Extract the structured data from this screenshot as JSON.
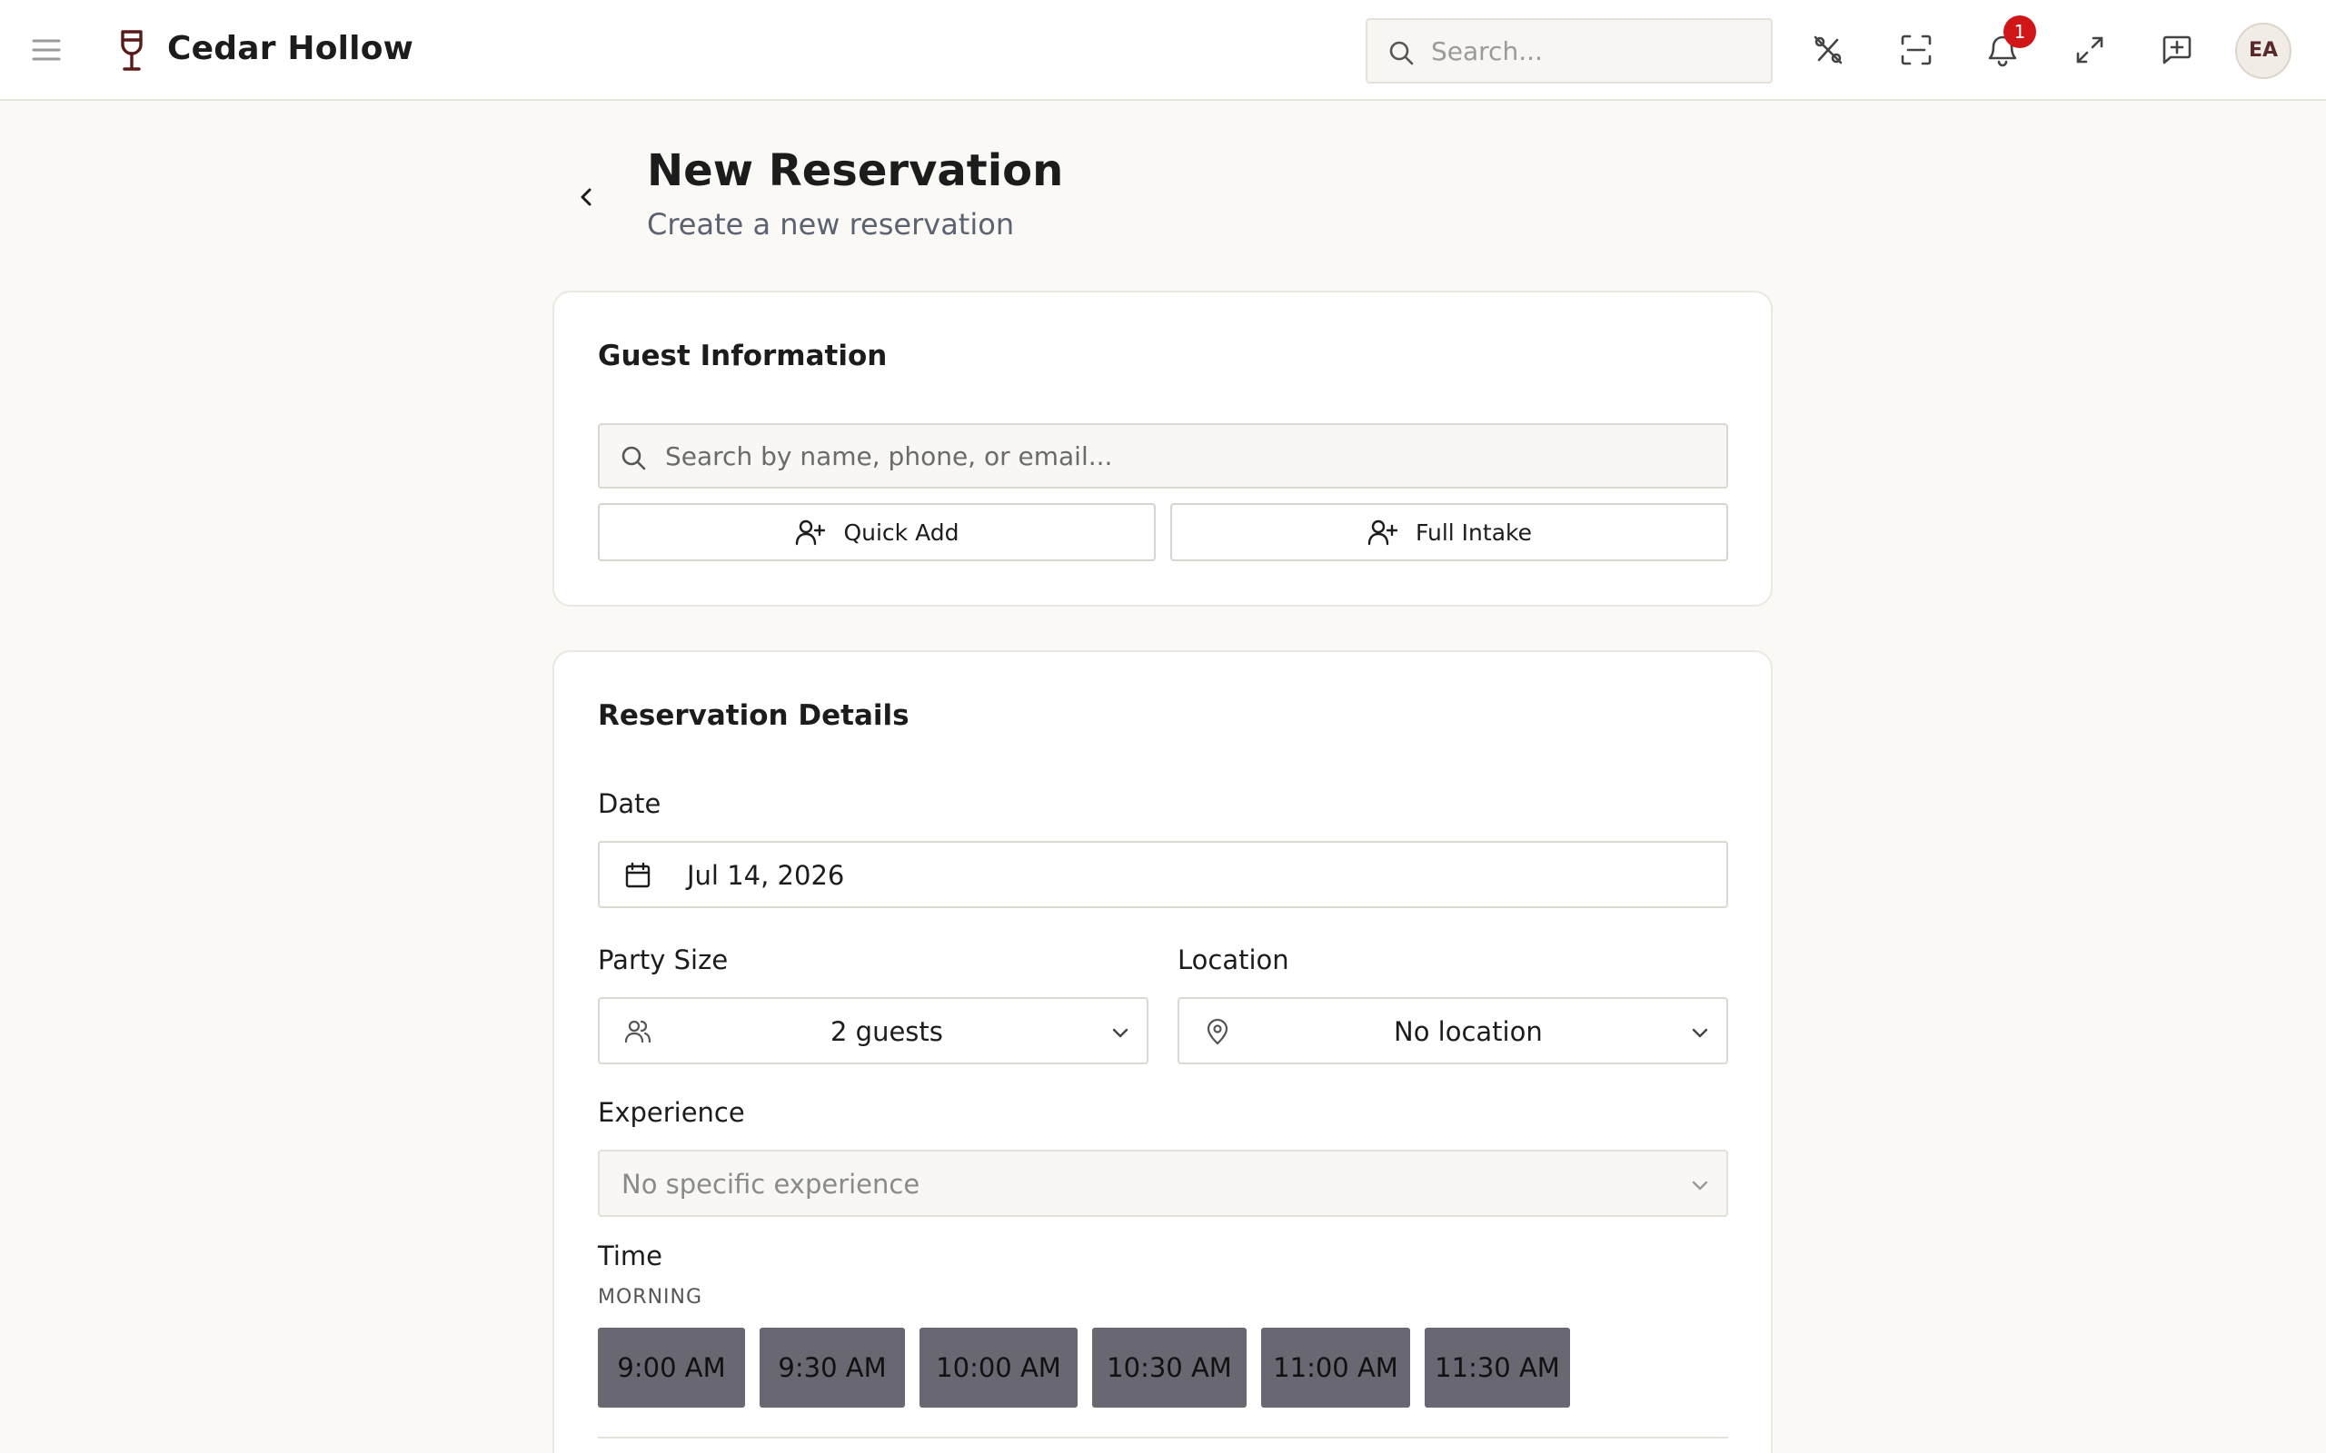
{
  "app": {
    "name": "Cedar Hollow"
  },
  "topbar": {
    "search_placeholder": "Search...",
    "notification_count": "1",
    "user_initials": "EA",
    "icons": [
      "menu-icon",
      "wine-glass-icon",
      "search-icon",
      "percent-slash-icon",
      "scan-icon",
      "bell-icon",
      "expand-icon",
      "message-plus-icon"
    ]
  },
  "header": {
    "title": "New Reservation",
    "subtitle": "Create a new reservation"
  },
  "guest": {
    "title": "Guest Information",
    "search_placeholder": "Search by name, phone, or email...",
    "quick_add_label": "Quick Add",
    "full_intake_label": "Full Intake"
  },
  "reservation": {
    "title": "Reservation Details",
    "date_label": "Date",
    "date_value": "Jul 14, 2026",
    "party_size_label": "Party Size",
    "party_size_value": "2 guests",
    "location_label": "Location",
    "location_value": "No location",
    "experience_label": "Experience",
    "experience_value": "No specific experience",
    "time_label": "Time",
    "morning_label": "MORNING",
    "times": [
      "9:00 AM",
      "9:30 AM",
      "10:00 AM",
      "10:30 AM",
      "11:00 AM",
      "11:30 AM"
    ]
  },
  "colors": {
    "brand": "#5a1a1a",
    "badge": "#d01616",
    "time_slot": "#696872",
    "background": "#faf9f6"
  }
}
